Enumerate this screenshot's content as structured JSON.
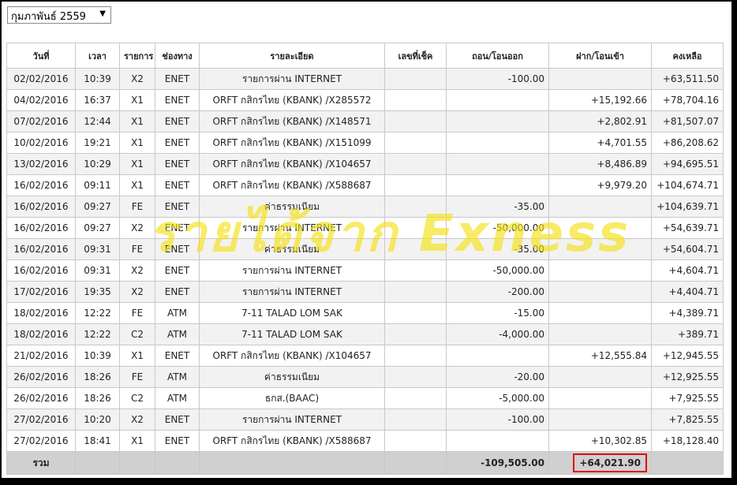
{
  "month_select": {
    "value": "กุมภาพันธ์ 2559"
  },
  "columns": [
    "วันที่",
    "เวลา",
    "รายการ",
    "ช่องทาง",
    "รายละเอียด",
    "เลขที่เช็ค",
    "ถอน/โอนออก",
    "ฝาก/โอนเข้า",
    "คงเหลือ"
  ],
  "rows": [
    {
      "date": "02/02/2016",
      "time": "10:39",
      "code": "X2",
      "channel": "ENET",
      "detail": "รายการผ่าน INTERNET",
      "cheque": "",
      "withdraw": "-100.00",
      "deposit": "",
      "balance": "+63,511.50"
    },
    {
      "date": "04/02/2016",
      "time": "16:37",
      "code": "X1",
      "channel": "ENET",
      "detail": "ORFT กสิกรไทย (KBANK) /X285572",
      "cheque": "",
      "withdraw": "",
      "deposit": "+15,192.66",
      "balance": "+78,704.16"
    },
    {
      "date": "07/02/2016",
      "time": "12:44",
      "code": "X1",
      "channel": "ENET",
      "detail": "ORFT กสิกรไทย (KBANK) /X148571",
      "cheque": "",
      "withdraw": "",
      "deposit": "+2,802.91",
      "balance": "+81,507.07"
    },
    {
      "date": "10/02/2016",
      "time": "19:21",
      "code": "X1",
      "channel": "ENET",
      "detail": "ORFT กสิกรไทย (KBANK) /X151099",
      "cheque": "",
      "withdraw": "",
      "deposit": "+4,701.55",
      "balance": "+86,208.62"
    },
    {
      "date": "13/02/2016",
      "time": "10:29",
      "code": "X1",
      "channel": "ENET",
      "detail": "ORFT กสิกรไทย (KBANK) /X104657",
      "cheque": "",
      "withdraw": "",
      "deposit": "+8,486.89",
      "balance": "+94,695.51"
    },
    {
      "date": "16/02/2016",
      "time": "09:11",
      "code": "X1",
      "channel": "ENET",
      "detail": "ORFT กสิกรไทย (KBANK) /X588687",
      "cheque": "",
      "withdraw": "",
      "deposit": "+9,979.20",
      "balance": "+104,674.71"
    },
    {
      "date": "16/02/2016",
      "time": "09:27",
      "code": "FE",
      "channel": "ENET",
      "detail": "ค่าธรรมเนียม",
      "cheque": "",
      "withdraw": "-35.00",
      "deposit": "",
      "balance": "+104,639.71"
    },
    {
      "date": "16/02/2016",
      "time": "09:27",
      "code": "X2",
      "channel": "ENET",
      "detail": "รายการผ่าน INTERNET",
      "cheque": "",
      "withdraw": "-50,000.00",
      "deposit": "",
      "balance": "+54,639.71"
    },
    {
      "date": "16/02/2016",
      "time": "09:31",
      "code": "FE",
      "channel": "ENET",
      "detail": "ค่าธรรมเนียม",
      "cheque": "",
      "withdraw": "-35.00",
      "deposit": "",
      "balance": "+54,604.71"
    },
    {
      "date": "16/02/2016",
      "time": "09:31",
      "code": "X2",
      "channel": "ENET",
      "detail": "รายการผ่าน INTERNET",
      "cheque": "",
      "withdraw": "-50,000.00",
      "deposit": "",
      "balance": "+4,604.71"
    },
    {
      "date": "17/02/2016",
      "time": "19:35",
      "code": "X2",
      "channel": "ENET",
      "detail": "รายการผ่าน INTERNET",
      "cheque": "",
      "withdraw": "-200.00",
      "deposit": "",
      "balance": "+4,404.71"
    },
    {
      "date": "18/02/2016",
      "time": "12:22",
      "code": "FE",
      "channel": "ATM",
      "detail": "7-11 TALAD LOM SAK",
      "cheque": "",
      "withdraw": "-15.00",
      "deposit": "",
      "balance": "+4,389.71"
    },
    {
      "date": "18/02/2016",
      "time": "12:22",
      "code": "C2",
      "channel": "ATM",
      "detail": "7-11 TALAD LOM SAK",
      "cheque": "",
      "withdraw": "-4,000.00",
      "deposit": "",
      "balance": "+389.71"
    },
    {
      "date": "21/02/2016",
      "time": "10:39",
      "code": "X1",
      "channel": "ENET",
      "detail": "ORFT กสิกรไทย (KBANK) /X104657",
      "cheque": "",
      "withdraw": "",
      "deposit": "+12,555.84",
      "balance": "+12,945.55"
    },
    {
      "date": "26/02/2016",
      "time": "18:26",
      "code": "FE",
      "channel": "ATM",
      "detail": "ค่าธรรมเนียม",
      "cheque": "",
      "withdraw": "-20.00",
      "deposit": "",
      "balance": "+12,925.55"
    },
    {
      "date": "26/02/2016",
      "time": "18:26",
      "code": "C2",
      "channel": "ATM",
      "detail": "ธกส.(BAAC)",
      "cheque": "",
      "withdraw": "-5,000.00",
      "deposit": "",
      "balance": "+7,925.55"
    },
    {
      "date": "27/02/2016",
      "time": "10:20",
      "code": "X2",
      "channel": "ENET",
      "detail": "รายการผ่าน INTERNET",
      "cheque": "",
      "withdraw": "-100.00",
      "deposit": "",
      "balance": "+7,825.55"
    },
    {
      "date": "27/02/2016",
      "time": "18:41",
      "code": "X1",
      "channel": "ENET",
      "detail": "ORFT กสิกรไทย (KBANK) /X588687",
      "cheque": "",
      "withdraw": "",
      "deposit": "+10,302.85",
      "balance": "+18,128.40"
    }
  ],
  "totals": {
    "label": "รวม",
    "withdraw": "-109,505.00",
    "deposit": "+64,021.90"
  },
  "watermark": "รายได้จาก Exness",
  "colors": {
    "highlight_border": "#e00000",
    "watermark": "#f5e114",
    "footer_bg": "#d0d0d0",
    "stripe": "#f2f2f2"
  }
}
